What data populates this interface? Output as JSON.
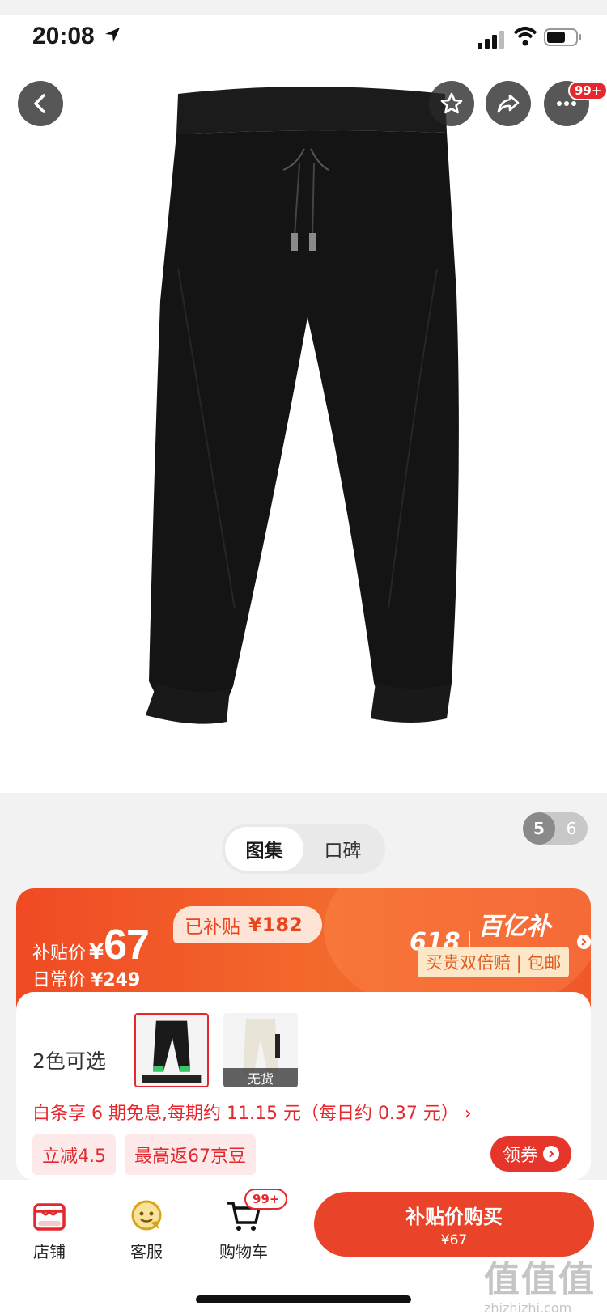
{
  "status_bar": {
    "time": "20:08"
  },
  "hero": {
    "page_current": "5",
    "page_total": "6",
    "more_badge": "99+"
  },
  "tabs": [
    {
      "label": "图集",
      "active": true
    },
    {
      "label": "口碑",
      "active": false
    }
  ],
  "price_card": {
    "subsidy_label": "补贴价",
    "currency": "¥",
    "subsidy_price": "67",
    "regular_label": "日常价",
    "regular_price": "¥249",
    "subsidized_label": "已补贴",
    "subsidized_amount": "¥182",
    "promo_618": "618",
    "promo_name": "百亿补贴",
    "guarantee": "买贵双倍赔 | 包邮",
    "colors_label": "2色可选",
    "swatches": [
      {
        "color": "black",
        "selected": true,
        "stock": ""
      },
      {
        "color": "cream",
        "selected": false,
        "stock": "无货"
      }
    ],
    "installment": "白条享 6 期免息,每期约 11.15 元（每日约 0.37 元） ›",
    "chip_discount": "立减4.5",
    "chip_beans": "最高返67京豆",
    "coupon": "领券"
  },
  "bottom_bar": {
    "store": "店铺",
    "service": "客服",
    "cart": "购物车",
    "cart_badge": "99+",
    "buy_line1": "补贴价购买",
    "buy_line2": "¥67"
  },
  "watermark": {
    "logo": "值值值",
    "url": "zhizhizhi.com"
  },
  "colors": {
    "accent": "#e4282d",
    "orange": "#f04a24"
  }
}
